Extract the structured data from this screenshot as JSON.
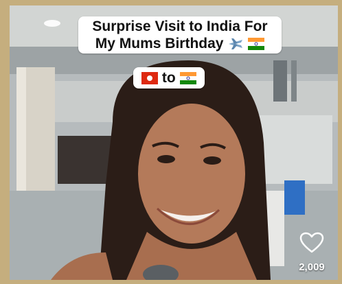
{
  "caption": {
    "line1": "Surprise Visit to India For",
    "line2": "My Mums Birthday",
    "line2_icons": [
      "airplane-emoji",
      "india-flag-emoji"
    ],
    "route_word": "to",
    "route_icons": [
      "hong-kong-flag-emoji",
      "india-flag-emoji"
    ]
  },
  "like": {
    "icon": "heart-outline-icon",
    "count": "2,009"
  },
  "colors": {
    "frame": "#c5ae7e",
    "caption_bg": "#ffffff",
    "caption_text": "#111111"
  }
}
